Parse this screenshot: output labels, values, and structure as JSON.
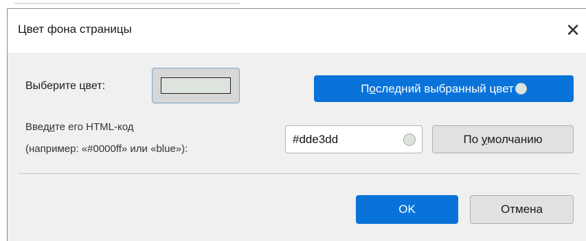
{
  "dialog": {
    "title": "Цвет фона страницы",
    "close_glyph": "✕"
  },
  "chooser": {
    "label": "Выберите цвет:",
    "current_color": "#dde3dd"
  },
  "last_color_button": {
    "label_prefix": "П",
    "label_underlined": "о",
    "label_suffix": "следний выбранный цвет",
    "color": "#dde3dd"
  },
  "html_code": {
    "label_line1_prefix": "Введ",
    "label_line1_underlined": "и",
    "label_line1_suffix": "те его HTML-код",
    "label_line2": "(например: «#0000ff» или «blue»):",
    "value": "#dde3dd",
    "preview_color": "#dde3dd"
  },
  "default_button": {
    "label_prefix": "По ",
    "label_underlined": "у",
    "label_suffix": "молчанию"
  },
  "footer": {
    "ok_label": "OK",
    "cancel_label": "Отмена"
  },
  "colors": {
    "accent": "#0a73d9",
    "dialog_bg": "#f0f0f0"
  },
  "icons": {
    "close": "close-icon",
    "color_dot": "color-dot-icon"
  }
}
